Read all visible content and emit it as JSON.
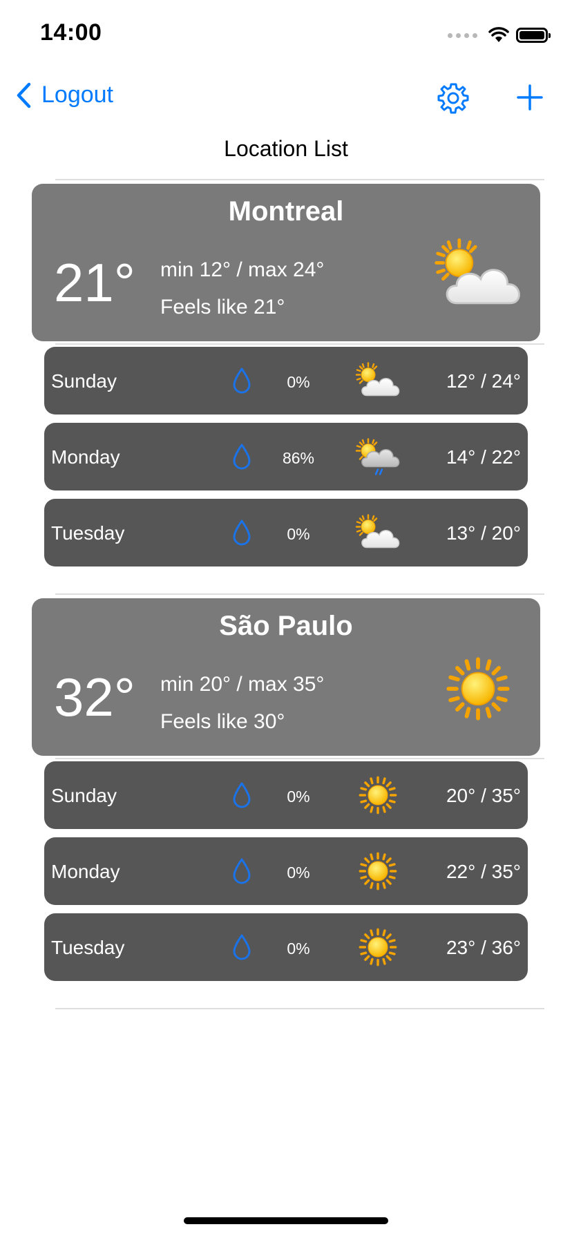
{
  "status_bar": {
    "time": "14:00"
  },
  "nav": {
    "back_label": "Logout",
    "settings_icon": "gear-icon",
    "add_icon": "plus-icon"
  },
  "page_title": "Location List",
  "colors": {
    "accent": "#007aff",
    "card_bg": "#7a7a7a",
    "row_bg": "#565656"
  },
  "locations": [
    {
      "name": "Montreal",
      "temp": "21°",
      "minmax": "min 12° / max 24°",
      "feels": "Feels like 21°",
      "icon": "partly-cloudy-icon",
      "days": [
        {
          "day": "Sunday",
          "precip": "0%",
          "icon": "partly-cloudy-icon",
          "temps": "12° / 24°"
        },
        {
          "day": "Monday",
          "precip": "86%",
          "icon": "rain-cloud-icon",
          "temps": "14° / 22°"
        },
        {
          "day": "Tuesday",
          "precip": "0%",
          "icon": "partly-cloudy-icon",
          "temps": "13° / 20°"
        }
      ]
    },
    {
      "name": "São Paulo",
      "temp": "32°",
      "minmax": "min 20° / max 35°",
      "feels": "Feels like 30°",
      "icon": "sun-icon",
      "days": [
        {
          "day": "Sunday",
          "precip": "0%",
          "icon": "sun-icon",
          "temps": "20° / 35°"
        },
        {
          "day": "Monday",
          "precip": "0%",
          "icon": "sun-icon",
          "temps": "22° / 35°"
        },
        {
          "day": "Tuesday",
          "precip": "0%",
          "icon": "sun-icon",
          "temps": "23° / 36°"
        }
      ]
    }
  ]
}
